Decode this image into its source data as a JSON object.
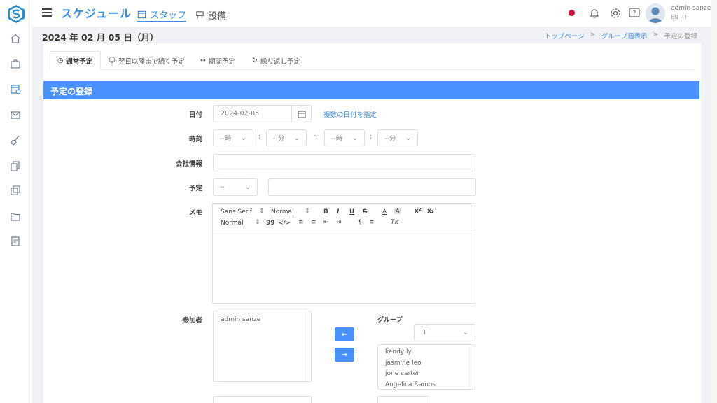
{
  "app": {
    "title": "スケジュール",
    "tabs": [
      {
        "label": "スタッフ",
        "icon": "calendar-icon"
      },
      {
        "label": "設備",
        "icon": "equipment-icon"
      }
    ],
    "user": {
      "name": "admin sanze",
      "sub": "EN -IT"
    },
    "colors": {
      "accent": "#3a8ee6",
      "section": "#4a90ff",
      "record_dot": "#d0103a"
    }
  },
  "sidebar": {
    "items": [
      {
        "icon": "home-icon"
      },
      {
        "icon": "briefcase-icon"
      },
      {
        "icon": "calendar-clock-icon"
      },
      {
        "icon": "mail-icon"
      },
      {
        "icon": "broom-icon"
      },
      {
        "icon": "document-copy-icon"
      },
      {
        "icon": "stack-icon"
      },
      {
        "icon": "folder-icon"
      },
      {
        "icon": "report-icon"
      }
    ]
  },
  "page": {
    "date": "2024 年 02 月 05 日（月）",
    "breadcrumb": [
      "トップページ",
      "グループ週表示",
      "予定の登録"
    ]
  },
  "tabs": [
    {
      "label": "通常予定",
      "icon": "clock-icon"
    },
    {
      "label": "翌日以降まで続く予定",
      "icon": "person-icon"
    },
    {
      "label": "期間予定",
      "icon": "range-icon"
    },
    {
      "label": "繰り返し予定",
      "icon": "repeat-icon"
    }
  ],
  "form": {
    "section_title": "予定の登録",
    "date_label": "日付",
    "date_value": "2024-02-05",
    "multi_date_link": "複数の日付を指定",
    "time_label": "時刻",
    "hour_placeholder": "--時",
    "minute_placeholder": "--分",
    "colon": ":",
    "tilde": "~",
    "company_label": "会社情報",
    "plan_label": "予定",
    "plan_select": "--",
    "memo_label": "メモ",
    "editor": {
      "font": "Sans Serif",
      "size": "Normal",
      "heading": "Normal",
      "bold": "B",
      "italic": "I",
      "underline": "U",
      "strike": "S",
      "color": "A",
      "background": "A",
      "superscript": "x²",
      "subscript": "x₂",
      "quote": "99",
      "code": "</>",
      "rtl": "¶",
      "clean": "Tx"
    },
    "participants_label": "参加者",
    "participants": [
      "admin sanze"
    ],
    "group_label": "グループ",
    "group_select": "IT",
    "group_members": [
      "kendy ly",
      "jasmine leo",
      "jone carter",
      "Angelica Ramos"
    ],
    "move_left": "←",
    "move_right": "→"
  }
}
